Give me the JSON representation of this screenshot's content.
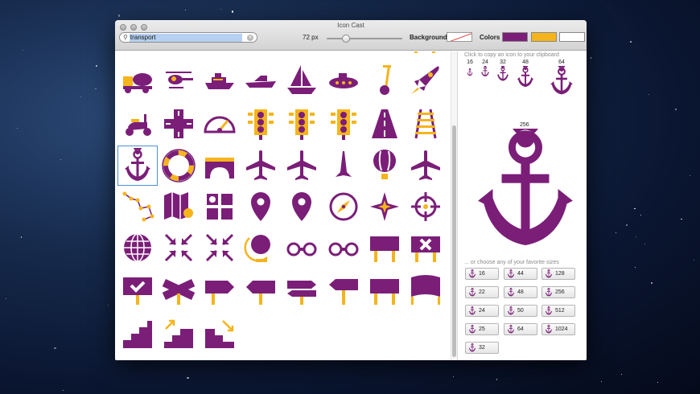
{
  "window": {
    "title": "Icon Cast"
  },
  "toolbar": {
    "search_value": "transport",
    "size_label": "72 px",
    "slider_fraction": 0.25,
    "background_label": "Background",
    "colors_label": "Colors"
  },
  "colors": {
    "primary": "#7b1e78",
    "secondary": "#f5b41c",
    "third": "#ffffff"
  },
  "grid": {
    "icons": [
      [
        "truck-mixer-icon",
        "helicopter-icon",
        "yacht-icon",
        "speedboat-icon",
        "sailboat-icon",
        "submarine-icon",
        "segway-icon",
        "rocket-icon"
      ],
      [
        "scooter-icon",
        "crossroads-icon",
        "speedometer-icon",
        "traffic-light-icon",
        "traffic-light-icon",
        "traffic-light-icon",
        "road-icon",
        "railroad-icon"
      ],
      [
        "anchor-icon",
        "lifebuoy-icon",
        "bridge-icon",
        "airplane-icon",
        "airplane-icon",
        "jet-icon",
        "hot-air-balloon-icon",
        "airplane-icon"
      ],
      [
        "constellation-icon",
        "map-pin-icon",
        "map-grid-icon",
        "location-pin-icon",
        "location-pin-icon",
        "compass-icon",
        "compass-rose-icon",
        "crosshair-icon"
      ],
      [
        "globe-icon",
        "collapse-arrows-icon",
        "collapse-arrows-icon",
        "desk-globe-icon",
        "binoculars-icon",
        "binoculars-icon",
        "sign-board-icon",
        "sign-cross-icon"
      ],
      [
        "sign-check-icon",
        "crossed-signs-icon",
        "sign-right-icon",
        "sign-double-icon",
        "sign-two-way-icon",
        "sign-left-icon",
        "sign-board-icon",
        "banner-icon"
      ],
      [
        "stairs-icon",
        "stairs-up-icon",
        "stairs-down-icon"
      ]
    ],
    "selected": "anchor-icon"
  },
  "preview": {
    "hint": "Click to copy an icon to your clipboard",
    "mini_sizes": [
      "16",
      "24",
      "32",
      "48",
      "64"
    ],
    "big_size_label": "256",
    "favorites_hint": "... or choose any of your favorite sizes",
    "size_buttons": [
      "16",
      "44",
      "128",
      "22",
      "48",
      "256",
      "24",
      "50",
      "512",
      "25",
      "64",
      "1024",
      "32"
    ]
  }
}
